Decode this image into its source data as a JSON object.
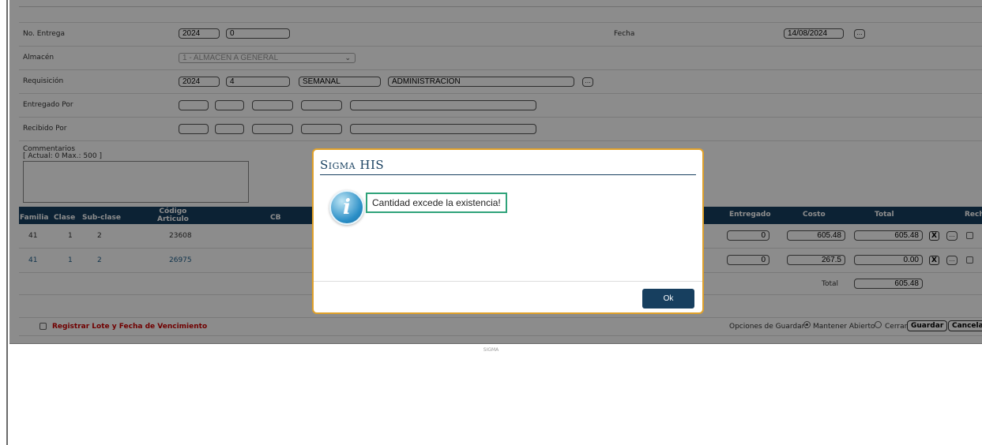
{
  "form": {
    "no_entrega_label": "No. Entrega",
    "no_entrega_year": "2024",
    "no_entrega_num": "0",
    "fecha_label": "Fecha",
    "fecha_value": "14/08/2024",
    "almacen_label": "Almacén",
    "almacen_value": "1 - ALMACEN A GENERAL",
    "requisicion_label": "Requisición",
    "req_year": "2024",
    "req_num": "4",
    "req_tipo": "SEMANAL",
    "req_depto": "ADMINISTRACION",
    "entregado_label": "Entregado Por",
    "recibido_label": "Recibido Por",
    "comentarios_label": "Commentarios",
    "comentarios_counter": "[ Actual: 0  Max.: 500 ]",
    "dots": "..."
  },
  "table": {
    "headers": {
      "familia": "Familia",
      "clase": "Clase",
      "subclase": "Sub-clase",
      "codigo_top": "Código",
      "codigo_bottom": "Articulo",
      "cb": "CB",
      "entregado": "Entregado",
      "costo": "Costo",
      "total": "Total",
      "rech": "Rech."
    },
    "rows": [
      {
        "familia": "41",
        "clase": "1",
        "subclase": "2",
        "codigo": "23608",
        "entregado": "0",
        "costo": "605.48",
        "total": "605.48"
      },
      {
        "familia": "41",
        "clase": "1",
        "subclase": "2",
        "codigo": "26975",
        "entregado": "0",
        "costo": "267.5",
        "total": "0.00"
      }
    ],
    "x_label": "X",
    "total_label": "Total",
    "grand_total": "605.48"
  },
  "footer": {
    "lote_label": "Registrar Lote y Fecha de Vencimiento",
    "opciones_label": "Opciones de Guardar:",
    "mantener_label": "Mantener Abierto",
    "cerrar_label": "Cerrar",
    "guardar_label": "Guardar",
    "cancelar_label": "Cancelar",
    "sigma": "SIGMA"
  },
  "dialog": {
    "title": "Sigma HIS",
    "message": "Cantidad excede la existencia!",
    "ok_label": "Ok",
    "icon": "info-icon"
  },
  "colors": {
    "header_navy": "#173f5f",
    "dialog_border": "#e0a12a",
    "message_border": "#2fa37a",
    "lote_red": "#cc0000"
  }
}
